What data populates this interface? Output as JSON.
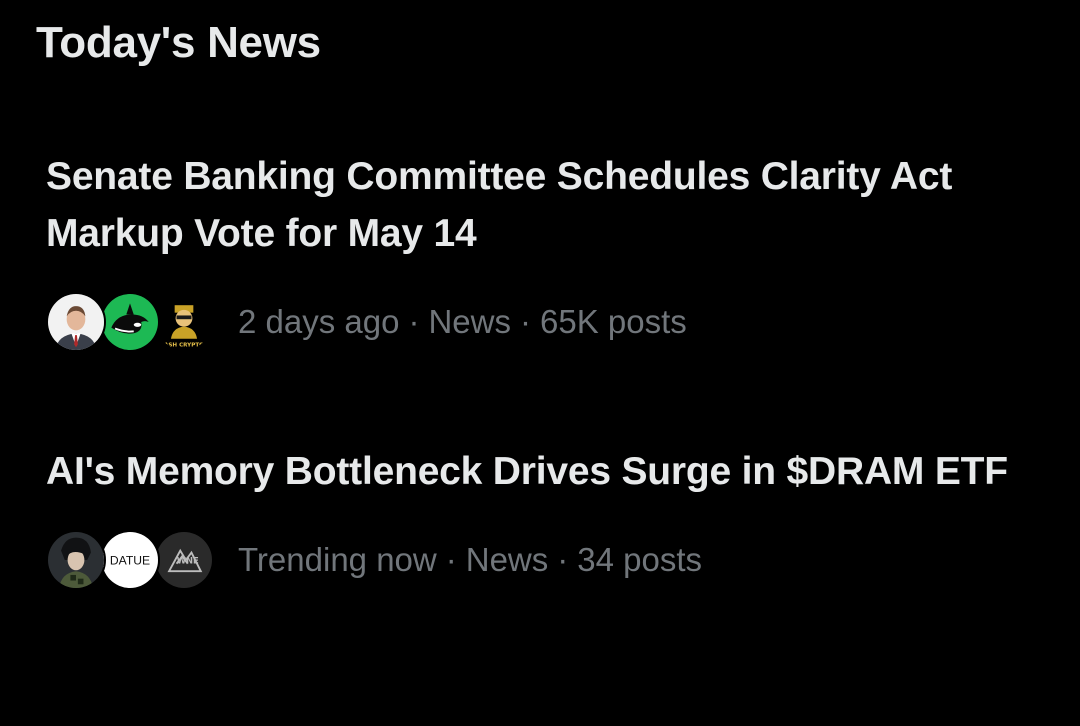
{
  "section": {
    "title": "Today's News"
  },
  "items": [
    {
      "headline": "Senate Banking Committee Schedules Clarity Act Markup Vote for May 14",
      "time": "2 days ago",
      "category": "News",
      "posts": "65K posts",
      "separator": "·",
      "avatars": [
        {
          "icon": "person-in-suit-avatar",
          "bg": "#f2f2f2"
        },
        {
          "icon": "orca-logo-avatar",
          "bg": "#1db954"
        },
        {
          "icon": "ash-crypto-avatar",
          "bg": "#000000",
          "text": "ASH CRYPTO"
        }
      ]
    },
    {
      "headline": "AI's Memory Bottleneck Drives Surge in $DRAM ETF",
      "time": "Trending now",
      "category": "News",
      "posts": "34 posts",
      "separator": "·",
      "avatars": [
        {
          "icon": "anime-character-avatar",
          "bg": "#2b2f33"
        },
        {
          "icon": "datue-logo-avatar",
          "bg": "#ffffff",
          "text": "DATUE"
        },
        {
          "icon": "mountain-logo-avatar",
          "bg": "#2a2a2a",
          "text": "WNE"
        }
      ]
    }
  ],
  "colors": {
    "background": "#000000",
    "primary_text": "#e7e9ea",
    "secondary_text": "#71767b"
  }
}
